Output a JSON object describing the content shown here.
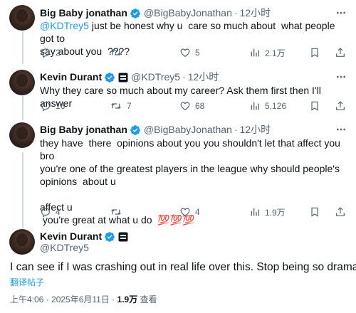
{
  "tweets": [
    {
      "name": "Big Baby jonathan",
      "handle": "@BigBabyJonathan",
      "time": "12小时",
      "mention": "@KDTrey5",
      "text": " just be honest why u  care so much about  what people got to\nsay about you  ????",
      "replies": "2",
      "retweets": "",
      "likes": "5",
      "views": "2.1万"
    },
    {
      "name": "Kevin Durant",
      "handle": "@KDTrey5",
      "time": "12小时",
      "text": "Why they care so much about my career? Ask them first then I'll answer",
      "replies": "16",
      "retweets": "7",
      "likes": "68",
      "views": "5,126"
    },
    {
      "name": "Big Baby jonathan",
      "handle": "@BigBabyJonathan",
      "time": "12小时",
      "text": "they have  there  opinions about you you shouldn't let that affect you bro\nyou're one of the greatest players in the league why should people's\nopinions  about u\n\naffect u\n you're great at what u do  💯💯💯",
      "replies": "4",
      "retweets": "",
      "likes": "4",
      "views": "1.9万"
    }
  ],
  "main_tweet": {
    "name": "Kevin Durant",
    "handle": "@KDTrey5",
    "text": "I can see if I was crashing out in real life over this. Stop being so dramatic",
    "translate_label": "翻译帖子",
    "datetime": "上午4:06 · 2025年6月11日 · ",
    "views_count": "1.9万",
    "views_label": " 查看"
  },
  "colors": {
    "accent": "#1d9bf0",
    "muted": "#536471",
    "text": "#0f1419",
    "thread_line": "#cfd9de"
  },
  "icons": [
    "verified-badge-icon",
    "affiliate-badge-icon",
    "more-icon",
    "reply-icon",
    "retweet-icon",
    "like-icon",
    "views-icon",
    "bookmark-icon",
    "share-icon"
  ]
}
